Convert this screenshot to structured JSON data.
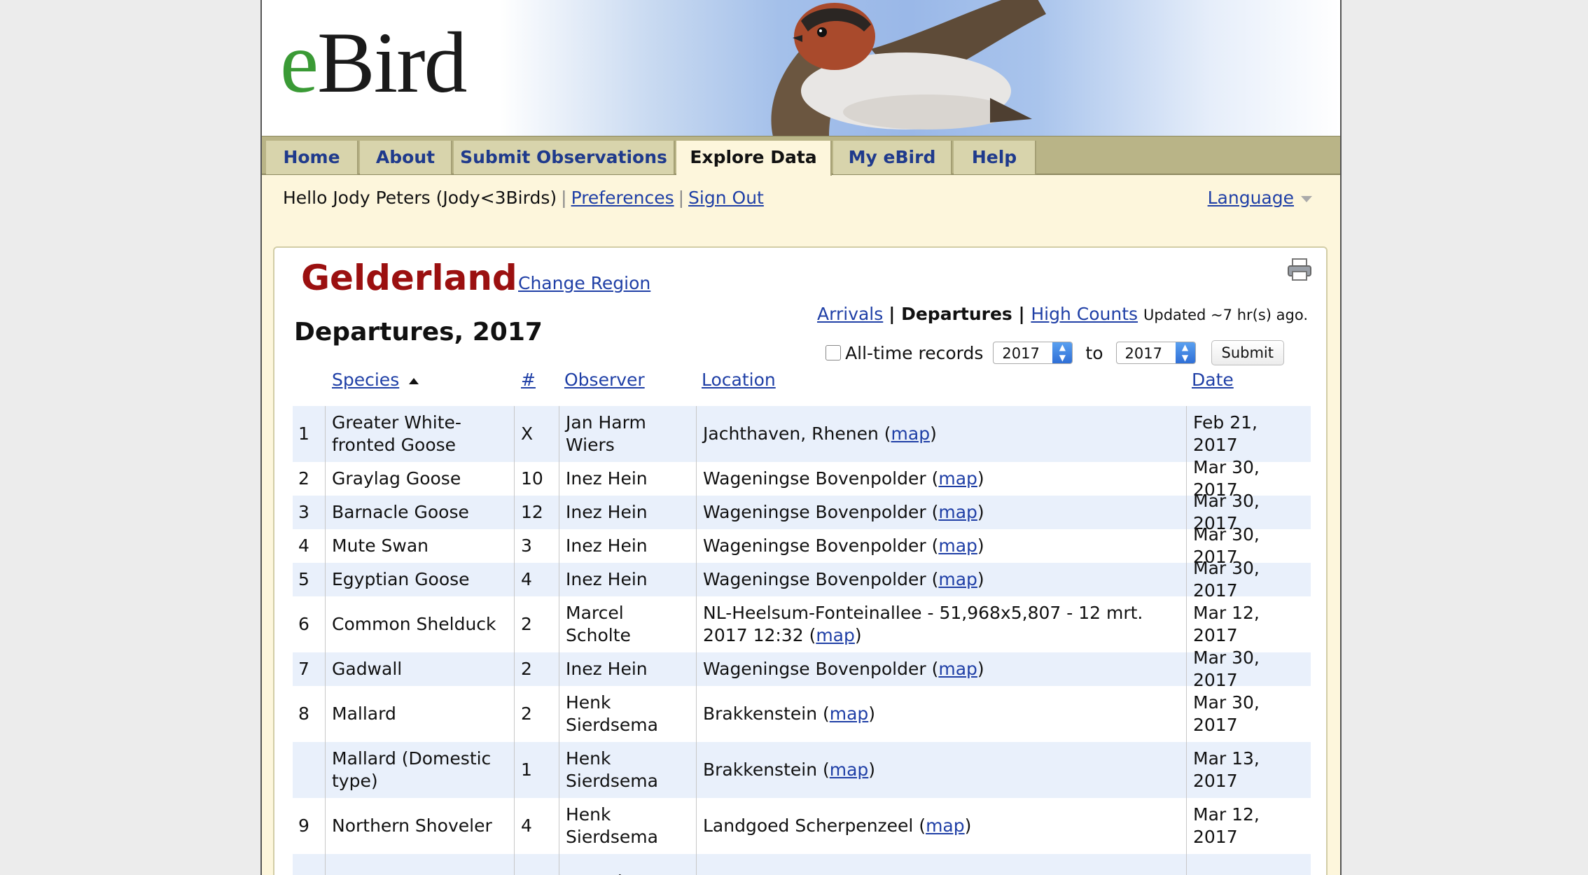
{
  "brand": {
    "logo_e": "e",
    "logo_rest": "Bird"
  },
  "nav": {
    "tabs": [
      {
        "label": "Home"
      },
      {
        "label": "About"
      },
      {
        "label": "Submit Observations"
      },
      {
        "label": "Explore Data",
        "active": true
      },
      {
        "label": "My eBird"
      },
      {
        "label": "Help"
      }
    ]
  },
  "user": {
    "greeting": "Hello Jody Peters (Jody<3Birds)",
    "preferences": "Preferences",
    "sign_out": "Sign Out",
    "language": "Language"
  },
  "region": {
    "name": "Gelderland",
    "change": "Change Region"
  },
  "report": {
    "title": "Departures, 2017",
    "modes": {
      "arrivals": "Arrivals",
      "departures": "Departures",
      "high_counts": "High Counts",
      "updated": "Updated ~7 hr(s) ago."
    },
    "filters": {
      "all_time": "All-time records",
      "from_year": "2017",
      "to_label": "to",
      "to_year": "2017",
      "submit": "Submit"
    }
  },
  "table": {
    "headers": {
      "species": "Species",
      "count": "#",
      "observer": "Observer",
      "location": "Location",
      "date": "Date"
    },
    "map_label": "map",
    "rows": [
      {
        "n": "1",
        "species": "Greater White-fronted Goose",
        "count": "X",
        "observer": "Jan Harm Wiers",
        "location": "Jachthaven, Rhenen",
        "date": "Feb 21, 2017"
      },
      {
        "n": "2",
        "species": "Graylag Goose",
        "count": "10",
        "observer": "Inez Hein",
        "location": "Wageningse Bovenpolder",
        "date": "Mar 30, 2017"
      },
      {
        "n": "3",
        "species": "Barnacle Goose",
        "count": "12",
        "observer": "Inez Hein",
        "location": "Wageningse Bovenpolder",
        "date": "Mar 30, 2017"
      },
      {
        "n": "4",
        "species": "Mute Swan",
        "count": "3",
        "observer": "Inez Hein",
        "location": "Wageningse Bovenpolder",
        "date": "Mar 30, 2017"
      },
      {
        "n": "5",
        "species": "Egyptian Goose",
        "count": "4",
        "observer": "Inez Hein",
        "location": "Wageningse Bovenpolder",
        "date": "Mar 30, 2017"
      },
      {
        "n": "6",
        "species": "Common Shelduck",
        "count": "2",
        "observer": "Marcel Scholte",
        "location": "NL-Heelsum-Fonteinallee - 51,968x5,807 - 12 mrt. 2017 12:32",
        "date": "Mar 12, 2017"
      },
      {
        "n": "7",
        "species": "Gadwall",
        "count": "2",
        "observer": "Inez Hein",
        "location": "Wageningse Bovenpolder",
        "date": "Mar 30, 2017"
      },
      {
        "n": "8",
        "species": "Mallard",
        "count": "2",
        "observer": "Henk Sierdsema",
        "location": "Brakkenstein",
        "date": "Mar 30, 2017"
      },
      {
        "n": "",
        "species": "Mallard (Domestic type)",
        "count": "1",
        "observer": "Henk Sierdsema",
        "location": "Brakkenstein",
        "date": "Mar 13, 2017"
      },
      {
        "n": "9",
        "species": "Northern Shoveler",
        "count": "4",
        "observer": "Henk Sierdsema",
        "location": "Landgoed Scherpenzeel",
        "date": "Mar 12, 2017"
      },
      {
        "n": "",
        "species": "",
        "count": "",
        "observer": "Antonius",
        "location": "",
        "date": ""
      }
    ]
  }
}
